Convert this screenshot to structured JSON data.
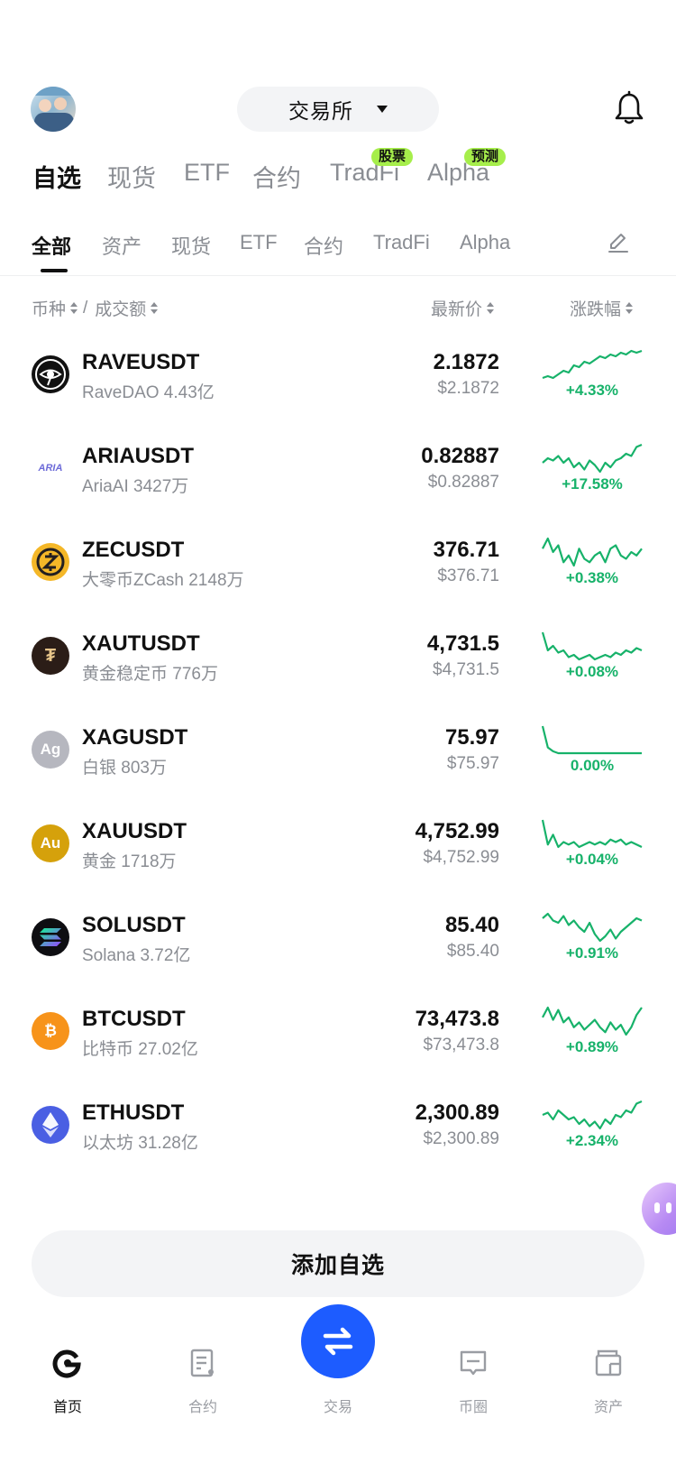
{
  "header": {
    "exchange_label": "交易所"
  },
  "main_tabs": [
    {
      "label": "自选",
      "active": true
    },
    {
      "label": "现货",
      "active": false
    },
    {
      "label": "ETF",
      "active": false
    },
    {
      "label": "合约",
      "active": false
    },
    {
      "label": "TradFi",
      "active": false,
      "badge": "股票"
    },
    {
      "label": "Alpha",
      "active": false,
      "badge": "预测"
    }
  ],
  "sub_tabs": [
    {
      "label": "全部",
      "active": true
    },
    {
      "label": "资产",
      "active": false
    },
    {
      "label": "现货",
      "active": false
    },
    {
      "label": "ETF",
      "active": false
    },
    {
      "label": "合约",
      "active": false
    },
    {
      "label": "TradFi",
      "active": false
    },
    {
      "label": "Alpha",
      "active": false
    }
  ],
  "columns": {
    "coin": "币种",
    "separator": "/",
    "volume": "成交额",
    "last_price": "最新价",
    "change": "涨跌幅"
  },
  "rows": [
    {
      "symbol": "RAVEUSDT",
      "sub": "RaveDAO 4.43亿",
      "price": "2.1872",
      "usd": "$2.1872",
      "change": "+4.33%",
      "icon": "rave-icon",
      "icon_text": "",
      "icon_bg": "#111111",
      "spark": [
        5,
        6,
        5,
        7,
        9,
        8,
        12,
        11,
        14,
        13,
        15,
        17,
        16,
        18,
        17,
        19,
        18,
        20,
        19,
        20
      ]
    },
    {
      "symbol": "ARIAUSDT",
      "sub": "AriaAI 3427万",
      "price": "0.82887",
      "usd": "$0.82887",
      "change": "+17.58%",
      "icon": "aria-icon",
      "icon_text": "ARIA",
      "icon_bg": "#ffffff",
      "spark": [
        12,
        14,
        13,
        15,
        12,
        14,
        10,
        12,
        9,
        13,
        11,
        8,
        12,
        10,
        13,
        14,
        16,
        15,
        19,
        20
      ]
    },
    {
      "symbol": "ZECUSDT",
      "sub": "大零币ZCash 2148万",
      "price": "376.71",
      "usd": "$376.71",
      "change": "+0.38%",
      "icon": "zcash-icon",
      "icon_text": "Z",
      "icon_bg": "#f4b728",
      "spark": [
        16,
        19,
        15,
        17,
        12,
        14,
        11,
        16,
        13,
        12,
        14,
        15,
        12,
        16,
        17,
        14,
        13,
        15,
        14,
        16
      ]
    },
    {
      "symbol": "XAUTUSDT",
      "sub": "黄金稳定币 776万",
      "price": "4,731.5",
      "usd": "$4,731.5",
      "change": "+0.08%",
      "icon": "tether-gold-icon",
      "icon_text": "₮",
      "icon_bg": "#2b1d17",
      "spark": [
        20,
        12,
        14,
        11,
        12,
        9,
        10,
        8,
        9,
        10,
        8,
        9,
        10,
        9,
        11,
        10,
        12,
        11,
        13,
        12
      ]
    },
    {
      "symbol": "XAGUSDT",
      "sub": "白银 803万",
      "price": "75.97",
      "usd": "$75.97",
      "change": "0.00%",
      "icon": "silver-icon",
      "icon_text": "Ag",
      "icon_bg": "#b6b7bf",
      "spark": [
        20,
        9,
        7,
        6,
        6,
        6,
        6,
        6,
        6,
        6,
        6,
        6,
        6,
        6,
        6,
        6,
        6,
        6,
        6,
        6
      ]
    },
    {
      "symbol": "XAUUSDT",
      "sub": "黄金 1718万",
      "price": "4,752.99",
      "usd": "$4,752.99",
      "change": "+0.04%",
      "icon": "gold-icon",
      "icon_text": "Au",
      "icon_bg": "#d5a10b",
      "spark": [
        20,
        10,
        14,
        9,
        11,
        10,
        11,
        9,
        10,
        11,
        10,
        11,
        10,
        12,
        11,
        12,
        10,
        11,
        10,
        9
      ]
    },
    {
      "symbol": "SOLUSDT",
      "sub": "Solana 3.72亿",
      "price": "85.40",
      "usd": "$85.40",
      "change": "+0.91%",
      "icon": "solana-icon",
      "icon_text": "",
      "icon_bg": "#0e0e12",
      "spark": [
        16,
        18,
        15,
        14,
        17,
        13,
        15,
        12,
        10,
        14,
        9,
        6,
        8,
        11,
        7,
        10,
        12,
        14,
        16,
        15
      ]
    },
    {
      "symbol": "BTCUSDT",
      "sub": "比特币 27.02亿",
      "price": "73,473.8",
      "usd": "$73,473.8",
      "change": "+0.89%",
      "icon": "bitcoin-icon",
      "icon_text": "₿",
      "icon_bg": "#f7931a",
      "spark": [
        14,
        18,
        13,
        17,
        12,
        14,
        10,
        12,
        9,
        11,
        13,
        10,
        8,
        12,
        9,
        11,
        7,
        10,
        15,
        18
      ]
    },
    {
      "symbol": "ETHUSDT",
      "sub": "以太坊 31.28亿",
      "price": "2,300.89",
      "usd": "$2,300.89",
      "change": "+2.34%",
      "icon": "ethereum-icon",
      "icon_text": "",
      "icon_bg": "#4a5fe3",
      "spark": [
        14,
        15,
        12,
        16,
        14,
        12,
        13,
        10,
        12,
        9,
        11,
        8,
        12,
        10,
        14,
        13,
        16,
        15,
        19,
        20
      ]
    }
  ],
  "add_button_label": "添加自选",
  "bottom_nav": [
    {
      "label": "首页",
      "icon": "home-icon",
      "active": true
    },
    {
      "label": "合约",
      "icon": "contract-icon",
      "active": false
    },
    {
      "label": "交易",
      "icon": "swap-icon",
      "active": false
    },
    {
      "label": "币圈",
      "icon": "community-icon",
      "active": false
    },
    {
      "label": "资产",
      "icon": "wallet-icon",
      "active": false
    }
  ],
  "colors": {
    "up_green": "#17b26a",
    "brand_blue": "#1d5cff",
    "badge_green": "#a6ee4b",
    "muted_text": "#8a8d93"
  }
}
